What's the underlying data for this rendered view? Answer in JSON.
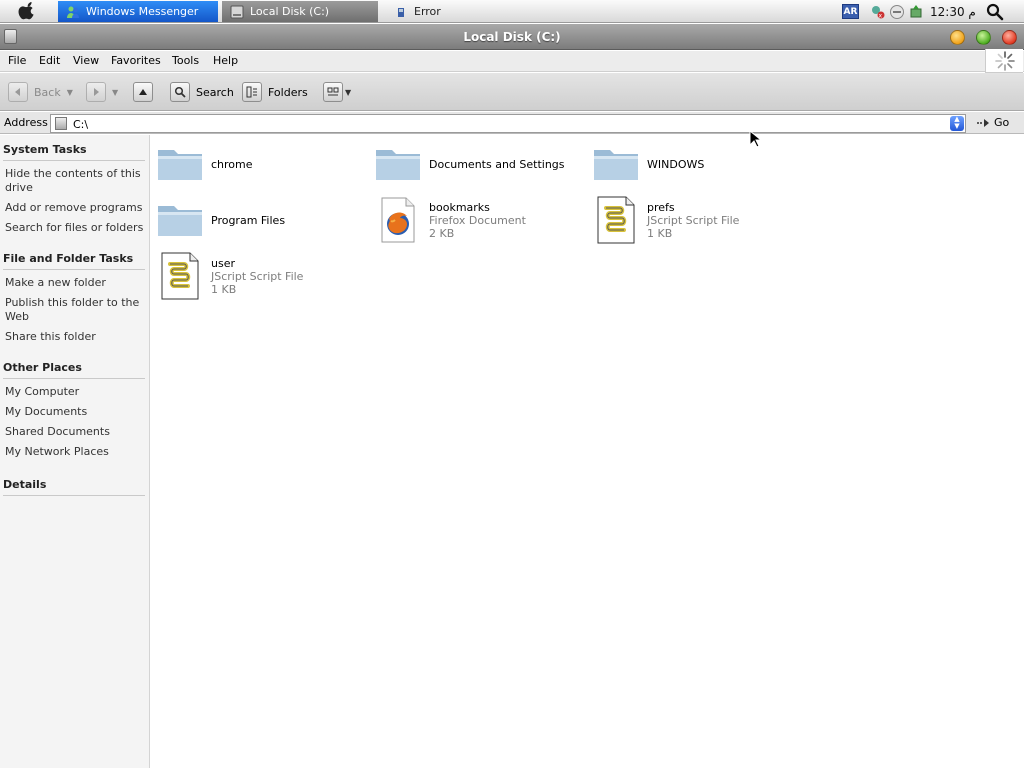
{
  "taskbar": {
    "tasks": [
      {
        "label": "Windows Messenger",
        "active": true
      },
      {
        "label": "Local Disk (C:)",
        "active": false
      },
      {
        "label": "Error",
        "active": false
      }
    ],
    "lang_badge": "AR",
    "clock": "12:30 م"
  },
  "window": {
    "title": "Local Disk (C:)"
  },
  "menu": [
    "File",
    "Edit",
    "View",
    "Favorites",
    "Tools",
    "Help"
  ],
  "toolbar": {
    "back_label": "Back",
    "search_label": "Search",
    "folders_label": "Folders"
  },
  "address": {
    "label": "Address",
    "value": "C:\\",
    "go_label": "Go"
  },
  "taskpane": {
    "system_tasks": {
      "title": "System Tasks",
      "links": [
        "Hide the contents of this drive",
        "Add or remove programs",
        "Search for files or folders"
      ]
    },
    "file_folder_tasks": {
      "title": "File and Folder Tasks",
      "links": [
        "Make a new folder",
        "Publish this folder to the Web",
        "Share this folder"
      ]
    },
    "other_places": {
      "title": "Other Places",
      "links": [
        "My Computer",
        "My Documents",
        "Shared Documents",
        "My Network Places"
      ]
    },
    "details": {
      "title": "Details"
    }
  },
  "files": [
    {
      "name": "chrome",
      "type": "",
      "size": "",
      "icon": "folder-icon"
    },
    {
      "name": "Documents and Settings",
      "type": "",
      "size": "",
      "icon": "folder-icon"
    },
    {
      "name": "WINDOWS",
      "type": "",
      "size": "",
      "icon": "folder-icon"
    },
    {
      "name": "Program Files",
      "type": "",
      "size": "",
      "icon": "folder-icon"
    },
    {
      "name": "bookmarks",
      "type": "Firefox Document",
      "size": "2 KB",
      "icon": "firefox-document-icon"
    },
    {
      "name": "prefs",
      "type": "JScript Script File",
      "size": "1 KB",
      "icon": "script-file-icon"
    },
    {
      "name": "user",
      "type": "JScript Script File",
      "size": "1 KB",
      "icon": "script-file-icon"
    }
  ]
}
